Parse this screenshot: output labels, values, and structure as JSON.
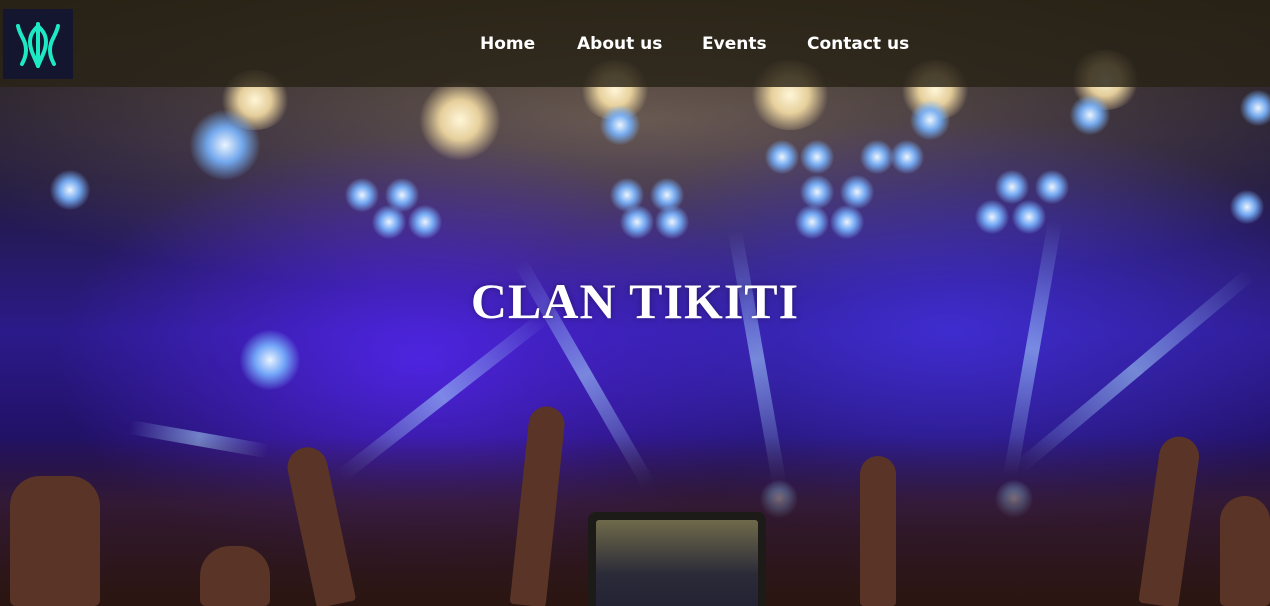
{
  "site": {
    "logo_icon": "trident-logo-icon",
    "logo_color": "#1de9c5"
  },
  "nav": {
    "items": [
      {
        "label": "Home"
      },
      {
        "label": "About us"
      },
      {
        "label": "Events"
      },
      {
        "label": "Contact us"
      }
    ]
  },
  "hero": {
    "title": "CLAN TIKITI",
    "background": "concert-crowd-image"
  }
}
